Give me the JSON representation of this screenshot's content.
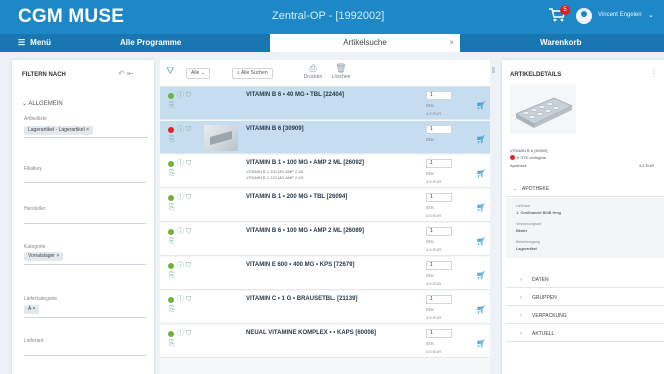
{
  "topbar": {
    "logo": "CGM MUSE",
    "window_title": "Zentral-OP - [1992002]",
    "cart_badge": "5",
    "user_name": "Vincent Engelen",
    "colors": {
      "header": "#1e88c7",
      "nav": "#1976b0",
      "selected_row": "#c6dcef",
      "red_dot": "#d9252b",
      "green_dot": "#6db23a"
    }
  },
  "navbar": {
    "menu_icon": "hamburger-icon",
    "menu_label": "Menü",
    "programs_label": "Alle Programme",
    "active_tab": "Artikelsuche",
    "tab_close": "×",
    "workflow_label": "Warenkorb"
  },
  "filter": {
    "title": "FILTERN NACH",
    "section": "ALLGEMEIN",
    "sortiment_label": "Artikelliste",
    "sortiment_chip": "Lagerartikel - Lagerartikel",
    "field_labels": [
      "Filialkey",
      "Hersteller",
      "Kategorie",
      "Lieferkategorie",
      "Lieferant"
    ],
    "kategorie_chip": "Vorratslager",
    "lieferkat_chip": "A"
  },
  "toolbar": {
    "filter_icon": "funnel-icon",
    "sort_label": "Alle",
    "search_label": "Alle Suchen",
    "action1": "Drucken",
    "action2": "Löschen",
    "expand_icon": "columns-icon"
  },
  "articles": [
    {
      "name": "VITAMIN B 6 • 40 MG • TBL [22404]",
      "sub": [
        "",
        ""
      ],
      "qty": "1",
      "unit": "STK",
      "price": "4,5 EUR",
      "status": "green",
      "selected": true
    },
    {
      "name": "VITAMIN B 6 [30909]",
      "sub": [
        "",
        ""
      ],
      "qty": "1",
      "unit": "STK",
      "price": "",
      "status": "red",
      "selected": true
    },
    {
      "name": "VITAMIN B 1 • 100 MG • AMP 2 ML [26092]",
      "sub": [
        "VITAMIN B 1 100 MG AMP 2 ML",
        "VITAMIN B 1 100 MG AMP 2 ML"
      ],
      "qty": "1",
      "unit": "STK",
      "price": "4,5 EUR",
      "status": "green",
      "selected": false
    },
    {
      "name": "VITAMIN B 1 • 200 MG • TBL [26094]",
      "sub": [
        "",
        ""
      ],
      "qty": "1",
      "unit": "STK",
      "price": "4,5 EUR",
      "status": "green",
      "selected": false
    },
    {
      "name": "VITAMIN B 6 • 100 MG • AMP 2 ML [26089]",
      "sub": [
        "",
        ""
      ],
      "qty": "1",
      "unit": "STK",
      "price": "4,5 EUR",
      "status": "green",
      "selected": false
    },
    {
      "name": "VITAMIN E 600 • 400 MG • KPS [72679]",
      "sub": [
        "",
        ""
      ],
      "qty": "1",
      "unit": "STK",
      "price": "4,5 EUR",
      "status": "green",
      "selected": false
    },
    {
      "name": "VITAMIN C • 1 G • BRAUSETBL. [21139]",
      "sub": [
        "",
        ""
      ],
      "qty": "1",
      "unit": "STK",
      "price": "4,5 EUR",
      "status": "green",
      "selected": false
    },
    {
      "name": "NEUAL VITAMINE KOMPLEX • • KAPS [60008]",
      "sub": [
        "",
        ""
      ],
      "qty": "1",
      "unit": "STK",
      "price": "4,5 EUR",
      "status": "green",
      "selected": false
    }
  ],
  "details": {
    "title": "ARTIKELDETAILS",
    "name": "VITAMIN B 6 [30909]",
    "stock": "0 STK verfügbar",
    "price_label": "Apotheke",
    "price_value": "4,5 EUR",
    "section_apotheke": "APOTHEKE",
    "apo_fields": [
      {
        "label": "Lieferant",
        "value": "1. Großhandel BMB Hmg"
      },
      {
        "label": "Verpackungsart",
        "value": "Blister"
      },
      {
        "label": "Bestellvorgang",
        "value": "Lagerartikel"
      }
    ],
    "accordion": [
      "DATEN",
      "GRUPPEN",
      "VERPACKUNG",
      "AKTUELL"
    ]
  }
}
